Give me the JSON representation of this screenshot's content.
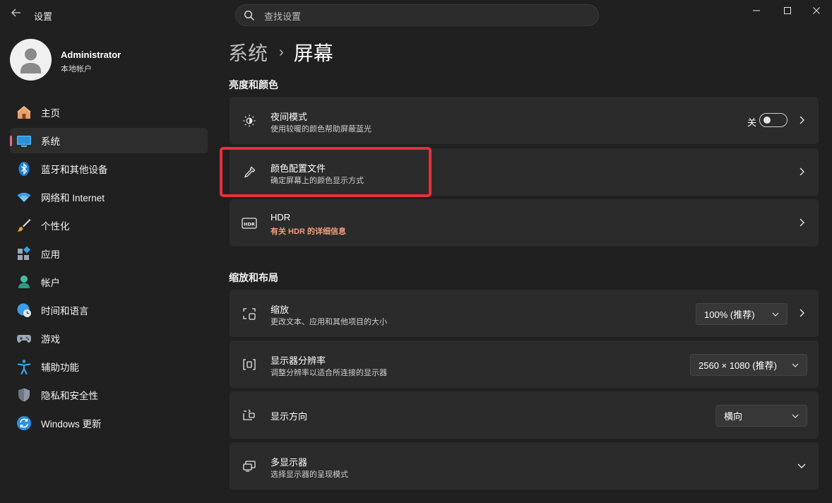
{
  "app": {
    "title": "设置"
  },
  "search": {
    "placeholder": "查找设置"
  },
  "profile": {
    "name": "Administrator",
    "account_type": "本地帐户"
  },
  "nav": {
    "items": [
      {
        "label": "主页",
        "icon": "home-icon"
      },
      {
        "label": "系统",
        "icon": "system-icon",
        "active": true
      },
      {
        "label": "蓝牙和其他设备",
        "icon": "bluetooth-icon"
      },
      {
        "label": "网络和 Internet",
        "icon": "wifi-icon"
      },
      {
        "label": "个性化",
        "icon": "brush-icon"
      },
      {
        "label": "应用",
        "icon": "apps-icon"
      },
      {
        "label": "帐户",
        "icon": "account-icon"
      },
      {
        "label": "时间和语言",
        "icon": "clock-globe-icon"
      },
      {
        "label": "游戏",
        "icon": "gamepad-icon"
      },
      {
        "label": "辅助功能",
        "icon": "accessibility-icon"
      },
      {
        "label": "隐私和安全性",
        "icon": "shield-icon"
      },
      {
        "label": "Windows 更新",
        "icon": "update-icon"
      }
    ]
  },
  "breadcrumb": {
    "parent": "系统",
    "separator": "›",
    "current": "屏幕"
  },
  "sections": {
    "brightness_color": {
      "heading": "亮度和颜色",
      "night_light": {
        "title": "夜间模式",
        "subtitle": "使用较暖的颜色帮助屏蔽蓝光",
        "toggle_label": "关",
        "toggle_on": false
      },
      "color_profile": {
        "title": "颜色配置文件",
        "subtitle": "确定屏幕上的颜色显示方式"
      },
      "hdr": {
        "title": "HDR",
        "link": "有关 HDR 的详细信息"
      }
    },
    "scale_layout": {
      "heading": "缩放和布局",
      "scale": {
        "title": "缩放",
        "subtitle": "更改文本、应用和其他项目的大小",
        "value": "100% (推荐)"
      },
      "resolution": {
        "title": "显示器分辨率",
        "subtitle": "调整分辨率以适合所连接的显示器",
        "value": "2560 × 1080 (推荐)"
      },
      "orientation": {
        "title": "显示方向",
        "value": "横向"
      },
      "multi_display": {
        "title": "多显示器",
        "subtitle": "选择显示器的呈现模式"
      }
    }
  },
  "colors": {
    "accent": "#e86e7f",
    "highlight_box": "#e8303a",
    "link": "#f0a07f",
    "background": "#202020",
    "card": "#2b2b2b"
  }
}
